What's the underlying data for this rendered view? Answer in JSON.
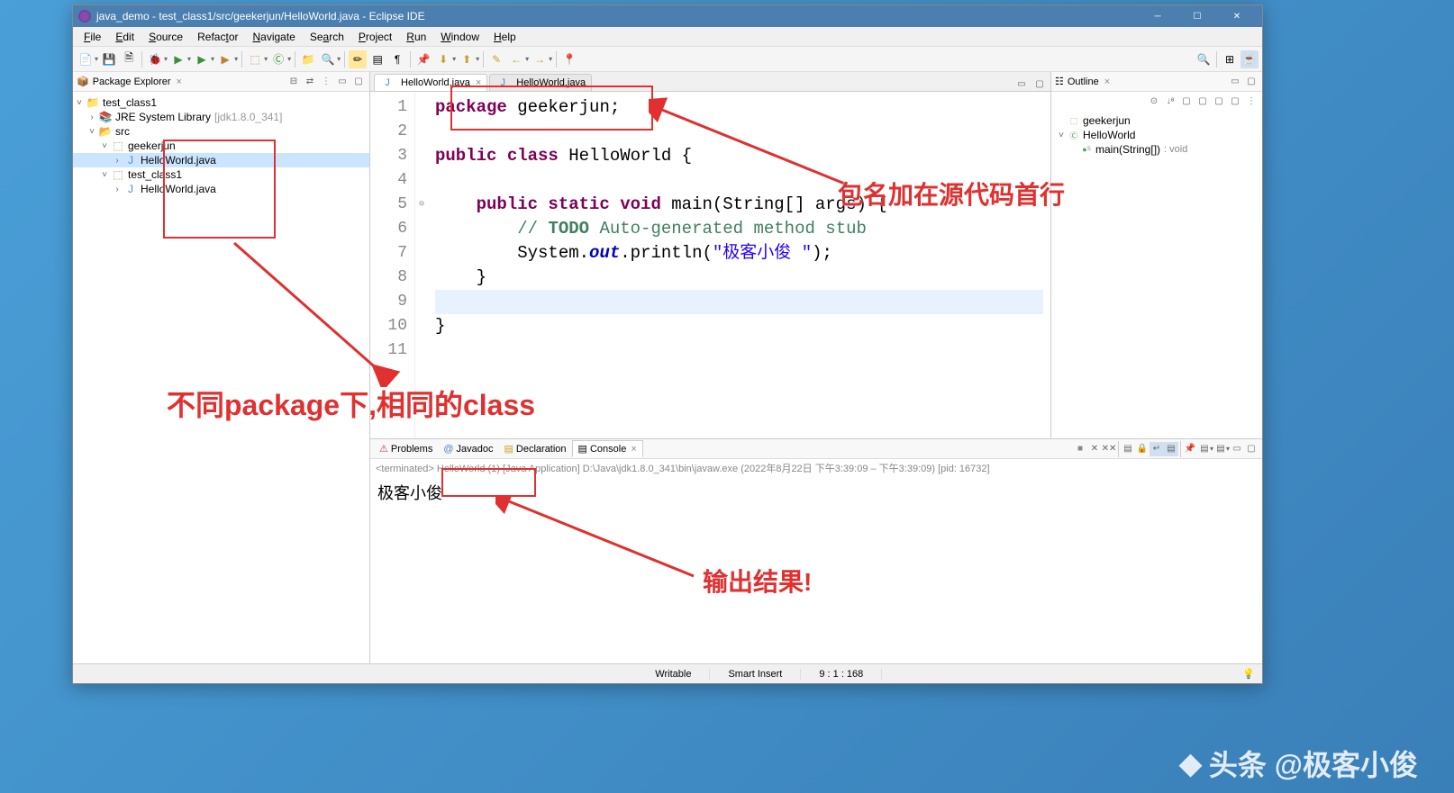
{
  "title": "java_demo - test_class1/src/geekerjun/HelloWorld.java - Eclipse IDE",
  "menu": [
    "File",
    "Edit",
    "Source",
    "Refactor",
    "Navigate",
    "Search",
    "Project",
    "Run",
    "Window",
    "Help"
  ],
  "packageExplorer": {
    "title": "Package Explorer",
    "project": "test_class1",
    "jre": "JRE System Library",
    "jre_ver": "[jdk1.8.0_341]",
    "src": "src",
    "pkg1": "geekerjun",
    "file1": "HelloWorld.java",
    "pkg2": "test_class1",
    "file2": "HelloWorld.java"
  },
  "editor": {
    "tab1": "HelloWorld.java",
    "tab2": "HelloWorld.java",
    "code": {
      "l1a": "package",
      "l1b": " geekerjun;",
      "l3a": "public class",
      "l3b": " HelloWorld {",
      "l5a": "public static void",
      "l5b": " main(String[] args) {",
      "l6a": "// ",
      "l6b": "TODO",
      "l6c": " Auto-generated method stub",
      "l7a": "System.",
      "l7b": "out",
      "l7c": ".println(",
      "l7d": "\"极客小俊 \"",
      "l7e": ");",
      "l8": "    }",
      "l10": "}"
    }
  },
  "outline": {
    "title": "Outline",
    "pkg": "geekerjun",
    "cls": "HelloWorld",
    "method": "main(String[])",
    "ret": ": void"
  },
  "bottom": {
    "tabs": {
      "problems": "Problems",
      "javadoc": "Javadoc",
      "decl": "Declaration",
      "console": "Console"
    },
    "terminated": "<terminated> HelloWorld (1) [Java Application] D:\\Java\\jdk1.8.0_341\\bin\\javaw.exe  (2022年8月22日 下午3:39:09 – 下午3:39:09) [pid: 16732]",
    "output": "极客小俊"
  },
  "status": {
    "writable": "Writable",
    "insert": "Smart Insert",
    "pos": "9 : 1 : 168"
  },
  "annotations": {
    "a1": "包名加在源代码首行",
    "a2": "不同package下,相同的class",
    "a3": "输出结果!"
  },
  "watermark": "头条 @极客小俊"
}
